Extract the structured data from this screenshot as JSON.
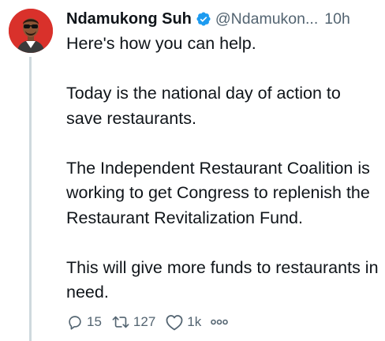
{
  "tweet": {
    "author_name": "Ndamukong Suh",
    "handle": "@Ndamukon...",
    "separator": "",
    "time": "10h",
    "paragraphs": [
      "Here's how you can help.",
      "Today is the national day of action to save restaurants.",
      "The Independent Restaurant Coalition is working to get Congress to replenish the Restaurant Revitalization Fund.",
      "This will give more funds to restaurants in need."
    ]
  },
  "actions": {
    "replies": "15",
    "retweets": "127",
    "likes": "1k"
  },
  "icons": {
    "verified": "verified-badge-icon",
    "reply": "reply-icon",
    "retweet": "retweet-icon",
    "like": "heart-icon",
    "more": "more-icon"
  },
  "colors": {
    "verified": "#1d9bf0",
    "secondary_text": "#536471",
    "avatar_bg": "#d9312b"
  }
}
